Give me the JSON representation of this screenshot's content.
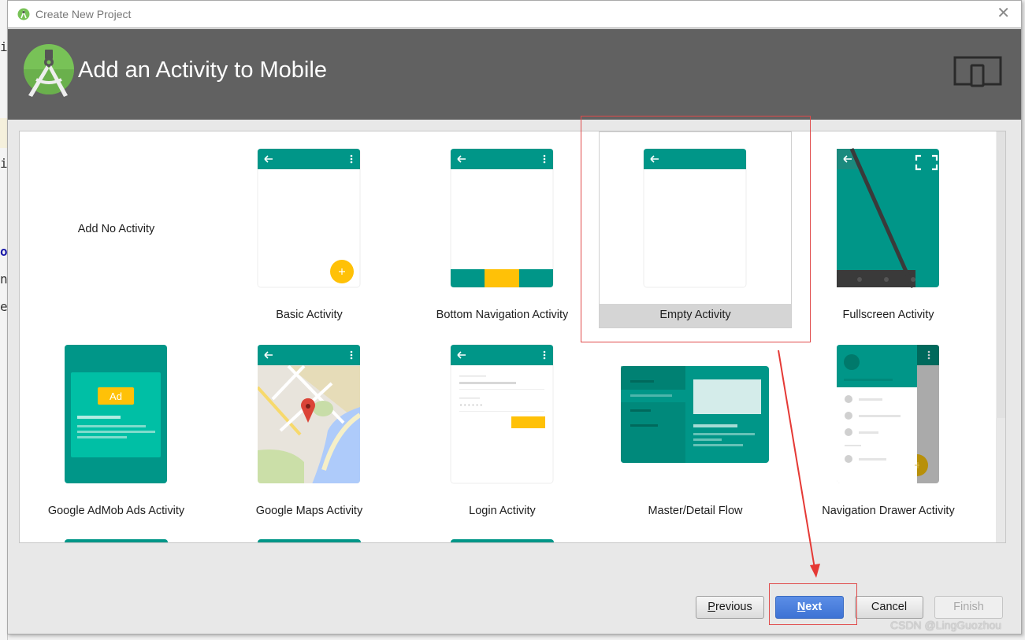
{
  "window": {
    "title": "Create New Project",
    "close_symbol": "✕"
  },
  "header": {
    "title": "Add an Activity to Mobile",
    "icons": [
      "android-studio-logo-icon",
      "phone-tablet-device-icon"
    ]
  },
  "gallery": {
    "templates": [
      {
        "label": "Add No Activity",
        "selected": false,
        "thumbnail": "none"
      },
      {
        "label": "Basic Activity",
        "selected": false,
        "thumbnail": "basic"
      },
      {
        "label": "Bottom Navigation Activity",
        "selected": false,
        "thumbnail": "bottom-nav"
      },
      {
        "label": "Empty Activity",
        "selected": true,
        "thumbnail": "empty"
      },
      {
        "label": "Fullscreen Activity",
        "selected": false,
        "thumbnail": "fullscreen"
      },
      {
        "label": "Google AdMob Ads Activity",
        "selected": false,
        "thumbnail": "admob",
        "badge": "Ad"
      },
      {
        "label": "Google Maps Activity",
        "selected": false,
        "thumbnail": "maps"
      },
      {
        "label": "Login Activity",
        "selected": false,
        "thumbnail": "login"
      },
      {
        "label": "Master/Detail Flow",
        "selected": false,
        "thumbnail": "master-detail"
      },
      {
        "label": "Navigation Drawer Activity",
        "selected": false,
        "thumbnail": "nav-drawer"
      }
    ]
  },
  "buttons": {
    "previous": {
      "mnemonic": "P",
      "rest": "revious",
      "enabled": true
    },
    "next": {
      "mnemonic": "N",
      "rest": "ext",
      "enabled": true,
      "default": true
    },
    "cancel": {
      "label": "Cancel",
      "enabled": true
    },
    "finish": {
      "label": "Finish",
      "enabled": false
    }
  },
  "colors": {
    "teal": "#009688",
    "teal_dark": "#00796b",
    "amber": "#ffc107",
    "header_bg": "#616161",
    "annotation_red": "#e04a4a",
    "selected_band": "#d5d5d5"
  },
  "watermark": "CSDN @LingGuozhou",
  "background_editor": {
    "chars": [
      "i",
      "i",
      "o",
      "n",
      "e"
    ]
  }
}
